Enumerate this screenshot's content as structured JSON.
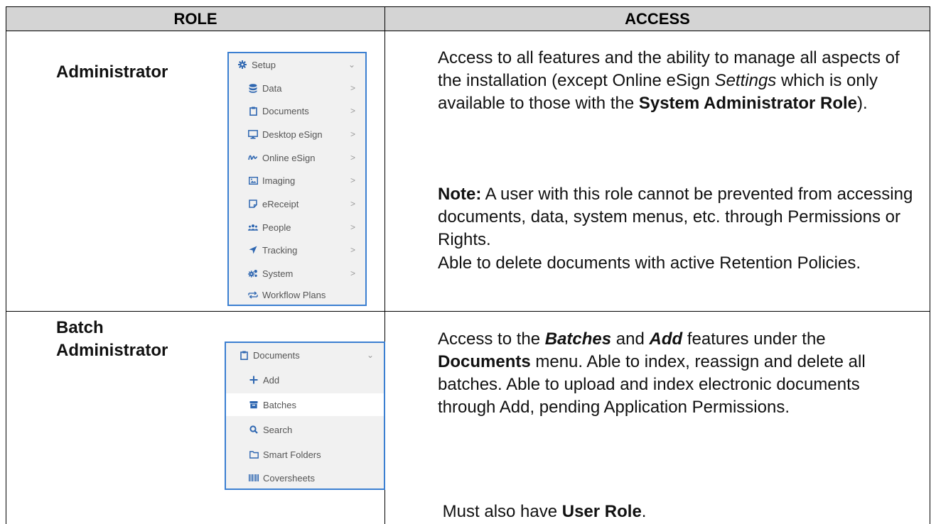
{
  "header": {
    "role": "ROLE",
    "access": "ACCESS"
  },
  "rows": [
    {
      "role_lines": [
        "Administrator"
      ],
      "menu": {
        "title": "Setup",
        "items": [
          {
            "label": "Data",
            "icon": "database-icon"
          },
          {
            "label": "Documents",
            "icon": "clipboard-icon"
          },
          {
            "label": "Desktop eSign",
            "icon": "monitor-icon"
          },
          {
            "label": "Online eSign",
            "icon": "signature-icon"
          },
          {
            "label": "Imaging",
            "icon": "image-icon"
          },
          {
            "label": "eReceipt",
            "icon": "receipt-icon"
          },
          {
            "label": "People",
            "icon": "people-icon"
          },
          {
            "label": "Tracking",
            "icon": "paper-plane-icon"
          },
          {
            "label": "System",
            "icon": "cogs-icon"
          },
          {
            "label": "Workflow Plans",
            "icon": "workflow-icon"
          }
        ]
      },
      "access": {
        "p1_text1": "Access to all features and the ability to manage all aspects of the installation (except Online eSign ",
        "p1_italic": "Settings",
        "p1_text2": " which is only available to those with the ",
        "p1_bold": "System Administrator Role",
        "p1_text3": ").",
        "note_label": "Note:",
        "note_text": "  A user with this role cannot be prevented from accessing documents, data, system menus, etc. through Permissions or Rights.",
        "p3": "Able to delete documents with active Retention Policies."
      }
    },
    {
      "role_lines": [
        "Batch",
        "Administrator"
      ],
      "menu": {
        "title": "Documents",
        "items": [
          {
            "label": "Add",
            "icon": "plus-icon"
          },
          {
            "label": "Batches",
            "icon": "archive-icon",
            "selected": true
          },
          {
            "label": "Search",
            "icon": "search-icon"
          },
          {
            "label": "Smart Folders",
            "icon": "folder-icon"
          },
          {
            "label": "Coversheets",
            "icon": "barcode-icon"
          }
        ]
      },
      "access": {
        "t1": "Access to the ",
        "b1": "Batches",
        "t2": " and ",
        "b2": "Add",
        "t3": " features under the ",
        "b3": "Documents",
        "t4": " menu.  Able to index, reassign and delete all batches.  Able to upload and index electronic documents through Add, pending Application Permissions.",
        "p2_text": " Must also have ",
        "p2_bold": "User Role",
        "p2_end": "."
      }
    }
  ],
  "colors": {
    "menu_border": "#3b7fd1",
    "menu_bg": "#f1f1f1",
    "header_bg": "#d4d4d4",
    "icon_blue": "#2f67b1"
  }
}
